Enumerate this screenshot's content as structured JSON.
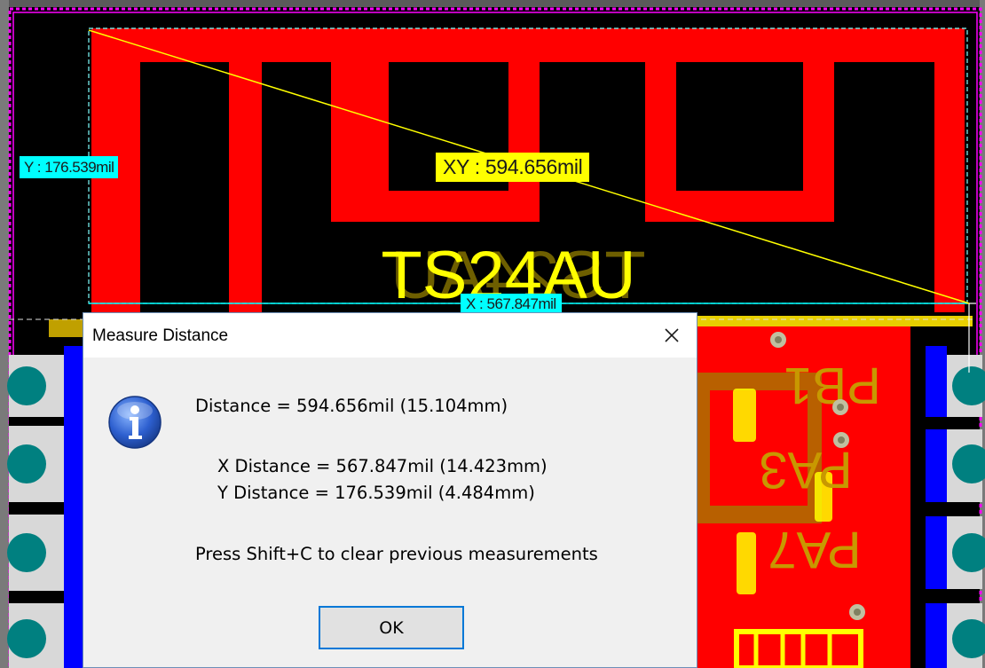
{
  "pcb": {
    "component_designator": "TS24AU",
    "silkscreen_labels": [
      "PB1",
      "PA3",
      "PA7"
    ],
    "measure_labels": {
      "y": "Y : 176.539mil",
      "xy": "XY : 594.656mil",
      "x": "X : 567.847mil"
    },
    "colors": {
      "board_background": "#000000",
      "top_copper": "#ff0000",
      "board_outline": "#ff00ff",
      "silkscreen": "#ffff00",
      "pad_copper": "#008080",
      "bottom_layer": "#0000ff",
      "mechanical_layer": "#c0a000",
      "measure_line": "#ffff00",
      "guide_lines": "#00ffff"
    }
  },
  "dialog": {
    "title": "Measure Distance",
    "icon": "info-icon",
    "close_icon": "close-icon",
    "distance_text": "Distance = 594.656mil (15.104mm)",
    "x_distance_text": "X Distance = 567.847mil (14.423mm)",
    "y_distance_text": "Y Distance = 176.539mil (4.484mm)",
    "clear_hint": "Press Shift+C to clear previous measurements",
    "ok_label": "OK"
  }
}
